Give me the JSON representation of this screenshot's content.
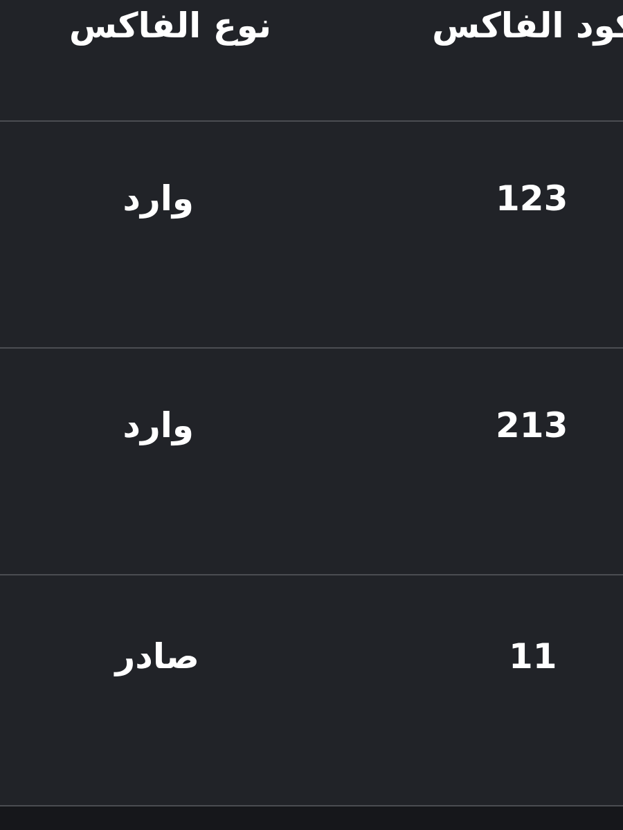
{
  "table": {
    "headers": {
      "type": "نوع الفاكس",
      "code": "كود الفاكس"
    },
    "rows": [
      {
        "type": "وارد",
        "code": "123"
      },
      {
        "type": "وارد",
        "code": "213"
      },
      {
        "type": "صادر",
        "code": "11"
      }
    ]
  }
}
